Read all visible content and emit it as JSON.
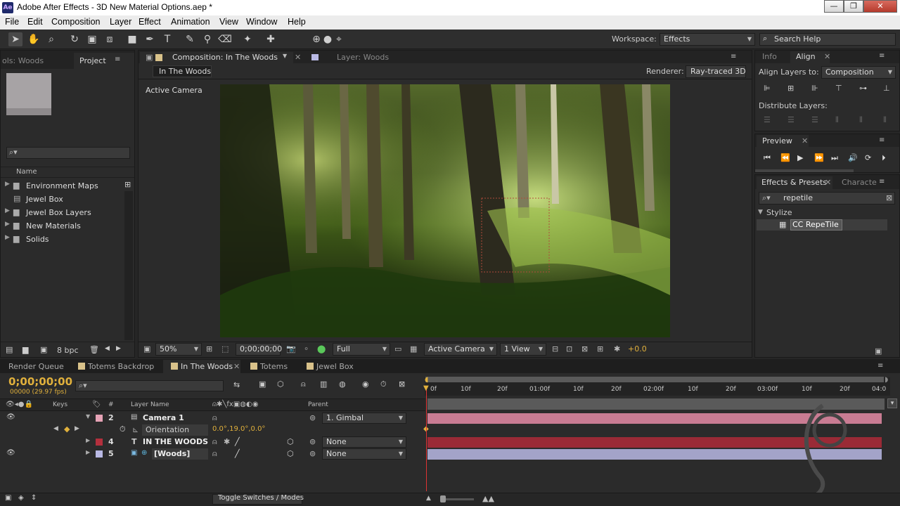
{
  "app": {
    "title": "Adobe After Effects - 3D New Material Options.aep *",
    "icon_text": "Ae"
  },
  "window_controls": {
    "minimize": "—",
    "maximize": "❐",
    "close": "✕"
  },
  "menu": [
    "File",
    "Edit",
    "Composition",
    "Layer",
    "Effect",
    "Animation",
    "View",
    "Window",
    "Help"
  ],
  "toolbar": {
    "workspace_label": "Workspace:",
    "workspace_value": "Effects",
    "search_placeholder": "Search Help"
  },
  "project_panel": {
    "tab_controls": "ols: Woods",
    "tab_project": "Project",
    "column_name": "Name",
    "items": [
      {
        "label": "Environment Maps",
        "type": "folder"
      },
      {
        "label": "Jewel Box",
        "type": "comp"
      },
      {
        "label": "Jewel Box Layers",
        "type": "folder"
      },
      {
        "label": "New Materials",
        "type": "folder"
      },
      {
        "label": "Solids",
        "type": "folder"
      }
    ],
    "bpc": "8 bpc"
  },
  "composition_panel": {
    "tab_comp": "Composition: In The Woods",
    "tab_layer": "Layer: Woods",
    "breadcrumb": "In The Woods",
    "renderer_label": "Renderer:",
    "renderer_value": "Ray-traced 3D",
    "view_label": "Active Camera",
    "footer": {
      "zoom": "50%",
      "timecode": "0;00;00;00",
      "resolution": "Full",
      "camera": "Active Camera",
      "views": "1 View",
      "exposure": "+0.0"
    }
  },
  "align_panel": {
    "tab_info": "Info",
    "tab_align": "Align",
    "align_to_label": "Align Layers to:",
    "align_to_value": "Composition",
    "distribute_label": "Distribute Layers:"
  },
  "preview_panel": {
    "title": "Preview"
  },
  "effects_panel": {
    "tab_effects": "Effects & Presets",
    "tab_character": "Characte",
    "search_value": "repetile",
    "category": "Stylize",
    "result": "CC RepeTile"
  },
  "timeline": {
    "tabs": [
      {
        "label": "Render Queue",
        "color": ""
      },
      {
        "label": "Totems Backdrop",
        "color": "#d9c28a"
      },
      {
        "label": "In The Woods",
        "color": "#d9c28a"
      },
      {
        "label": "Totems",
        "color": "#d9c28a"
      },
      {
        "label": "Jewel Box",
        "color": "#d9c28a"
      }
    ],
    "timecode": "0;00;00;00",
    "fps": "00000 (29.97 fps)",
    "headers": {
      "keys": "Keys",
      "number": "#",
      "layer_name": "Layer Name",
      "parent": "Parent"
    },
    "ruler": [
      "0f",
      "10f",
      "20f",
      "01:00f",
      "10f",
      "20f",
      "02:00f",
      "10f",
      "20f",
      "03:00f",
      "10f",
      "20f",
      "04:0"
    ],
    "layers": [
      {
        "num": "2",
        "name": "Camera 1",
        "label_color": "#e6a3b6",
        "parent": "1. Gimbal",
        "bar_color": "#c97c93"
      },
      {
        "num": "4",
        "name": "IN THE WOODS",
        "label_color": "#b4303d",
        "parent": "None",
        "bar_color": "#9a2a36"
      },
      {
        "num": "5",
        "name": "[Woods]",
        "label_color": "#b9b9e4",
        "parent": "None",
        "bar_color": "#a3a3c9"
      }
    ],
    "property": {
      "name": "Orientation",
      "value": "0.0°,19.0°,0.0°"
    },
    "toggle_label": "Toggle Switches / Modes"
  }
}
